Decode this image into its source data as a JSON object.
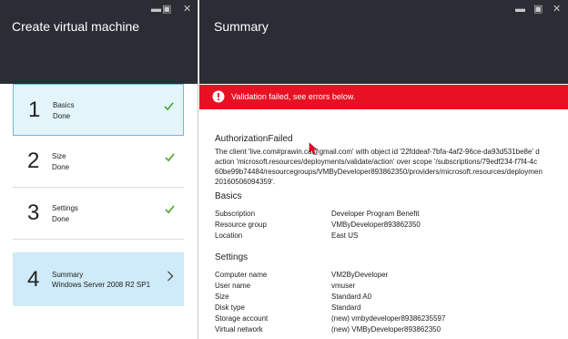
{
  "left_blade": {
    "title": "Create virtual machine",
    "controls": {
      "minimize": "▬",
      "maximize": "▣",
      "close": "✕"
    },
    "steps": [
      {
        "number": "1",
        "title": "Basics",
        "subtitle": "Done",
        "status": "done"
      },
      {
        "number": "2",
        "title": "Size",
        "subtitle": "Done",
        "status": "done"
      },
      {
        "number": "3",
        "title": "Settings",
        "subtitle": "Done",
        "status": "done"
      },
      {
        "number": "4",
        "title": "Summary",
        "subtitle": "Windows Server 2008 R2 SP1",
        "status": "current"
      }
    ]
  },
  "right_blade": {
    "title": "Summary",
    "controls": {
      "minimize": "▬",
      "maximize": "▣",
      "close": "✕"
    },
    "error_banner": {
      "text": "Validation failed, see errors below.",
      "color": "#e81123"
    },
    "error": {
      "heading": "AuthorizationFailed",
      "lines": [
        "The client 'live.com#prawin.ca@gmail.com' with object id '22fddeaf-7bfa-4af2-96ce-da93d531be8e' d",
        "action 'microsoft.resources/deployments/validate/action' over scope '/subscriptions/79edf234-f7f4-4c",
        "60be99b74484/resourcegroups/VMByDeveloper893862350/providers/microsoft.resources/deploymen",
        "20160506094359'."
      ]
    },
    "basics": {
      "heading": "Basics",
      "rows": [
        {
          "key": "Subscription",
          "value": "Developer Program Benefit"
        },
        {
          "key": "Resource group",
          "value": "VMByDeveloper893862350"
        },
        {
          "key": "Location",
          "value": "East US"
        }
      ]
    },
    "settings": {
      "heading": "Settings",
      "rows": [
        {
          "key": "Computer name",
          "value": "VM2ByDeveloper"
        },
        {
          "key": "User name",
          "value": "vmuser"
        },
        {
          "key": "Size",
          "value": "Standard A0"
        },
        {
          "key": "Disk type",
          "value": "Standard"
        },
        {
          "key": "Storage account",
          "value": "(new) vmbydeveloper89386235597"
        },
        {
          "key": "Virtual network",
          "value": "(new) VMByDeveloper893862350"
        }
      ]
    }
  },
  "colors": {
    "header": "#2a2d33",
    "check": "#4ea72e",
    "active_border": "#6fb9e2",
    "current_bg": "#cfeaf8"
  }
}
